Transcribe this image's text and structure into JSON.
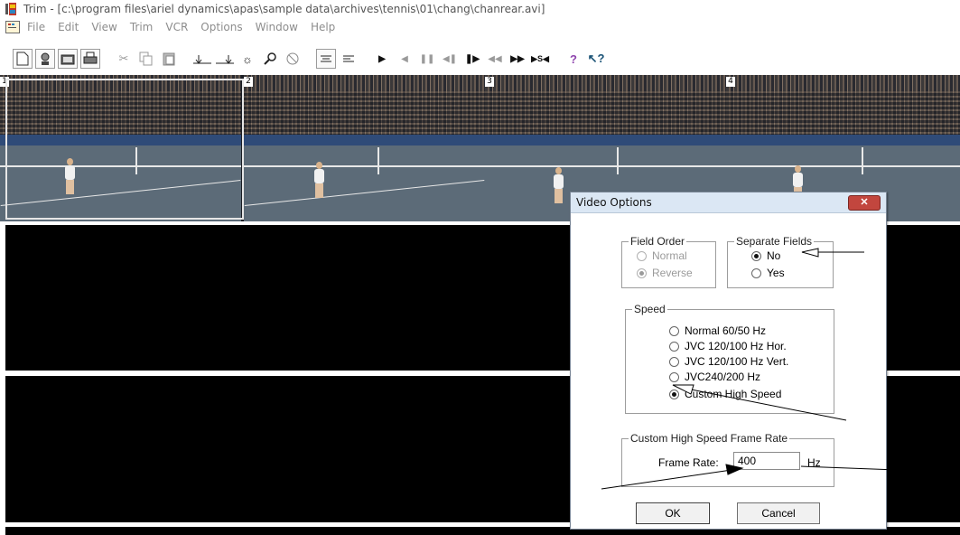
{
  "window": {
    "title": "Trim - [c:\\program files\\ariel dynamics\\apas\\sample data\\archives\\tennis\\01\\chang\\chanrear.avi]"
  },
  "menu": {
    "items": [
      "File",
      "Edit",
      "View",
      "Trim",
      "VCR",
      "Options",
      "Window",
      "Help"
    ]
  },
  "toolbar": {
    "icons": [
      "new-icon",
      "record-icon",
      "open-icon",
      "print-icon",
      "cut-icon",
      "copy-icon",
      "paste-icon",
      "mark-in-icon",
      "mark-out-icon",
      "brightness-icon",
      "zoom-icon",
      "stop-zoom-icon",
      "align-center-icon",
      "align-left-icon",
      "play-icon",
      "step-back-icon",
      "pause-icon",
      "frame-back-icon",
      "frame-forward-icon",
      "rewind-icon",
      "fast-forward-icon",
      "seek-icon",
      "help-icon",
      "context-help-icon"
    ]
  },
  "frames": {
    "labels": [
      "1",
      "2",
      "3",
      "4"
    ]
  },
  "dialog": {
    "title": "Video Options",
    "close_label": "✕",
    "field_order": {
      "label": "Field Order",
      "options": [
        "Normal",
        "Reverse"
      ],
      "selected": "Reverse",
      "enabled": false
    },
    "separate_fields": {
      "label": "Separate Fields",
      "options": [
        "No",
        "Yes"
      ],
      "selected": "No"
    },
    "speed": {
      "label": "Speed",
      "options": [
        "Normal 60/50 Hz",
        "JVC 120/100 Hz Hor.",
        "JVC 120/100 Hz Vert.",
        "JVC240/200 Hz",
        "Custom High Speed"
      ],
      "selected": "Custom High Speed"
    },
    "custom_rate": {
      "label": "Custom High Speed Frame Rate",
      "field_label": "Frame Rate:",
      "value": "400",
      "unit": "Hz"
    },
    "ok_label": "OK",
    "cancel_label": "Cancel"
  },
  "colors": {
    "close_button": "#c2463e",
    "dialog_title_bg": "#dbe7f4",
    "pane_bg": "#000000"
  }
}
